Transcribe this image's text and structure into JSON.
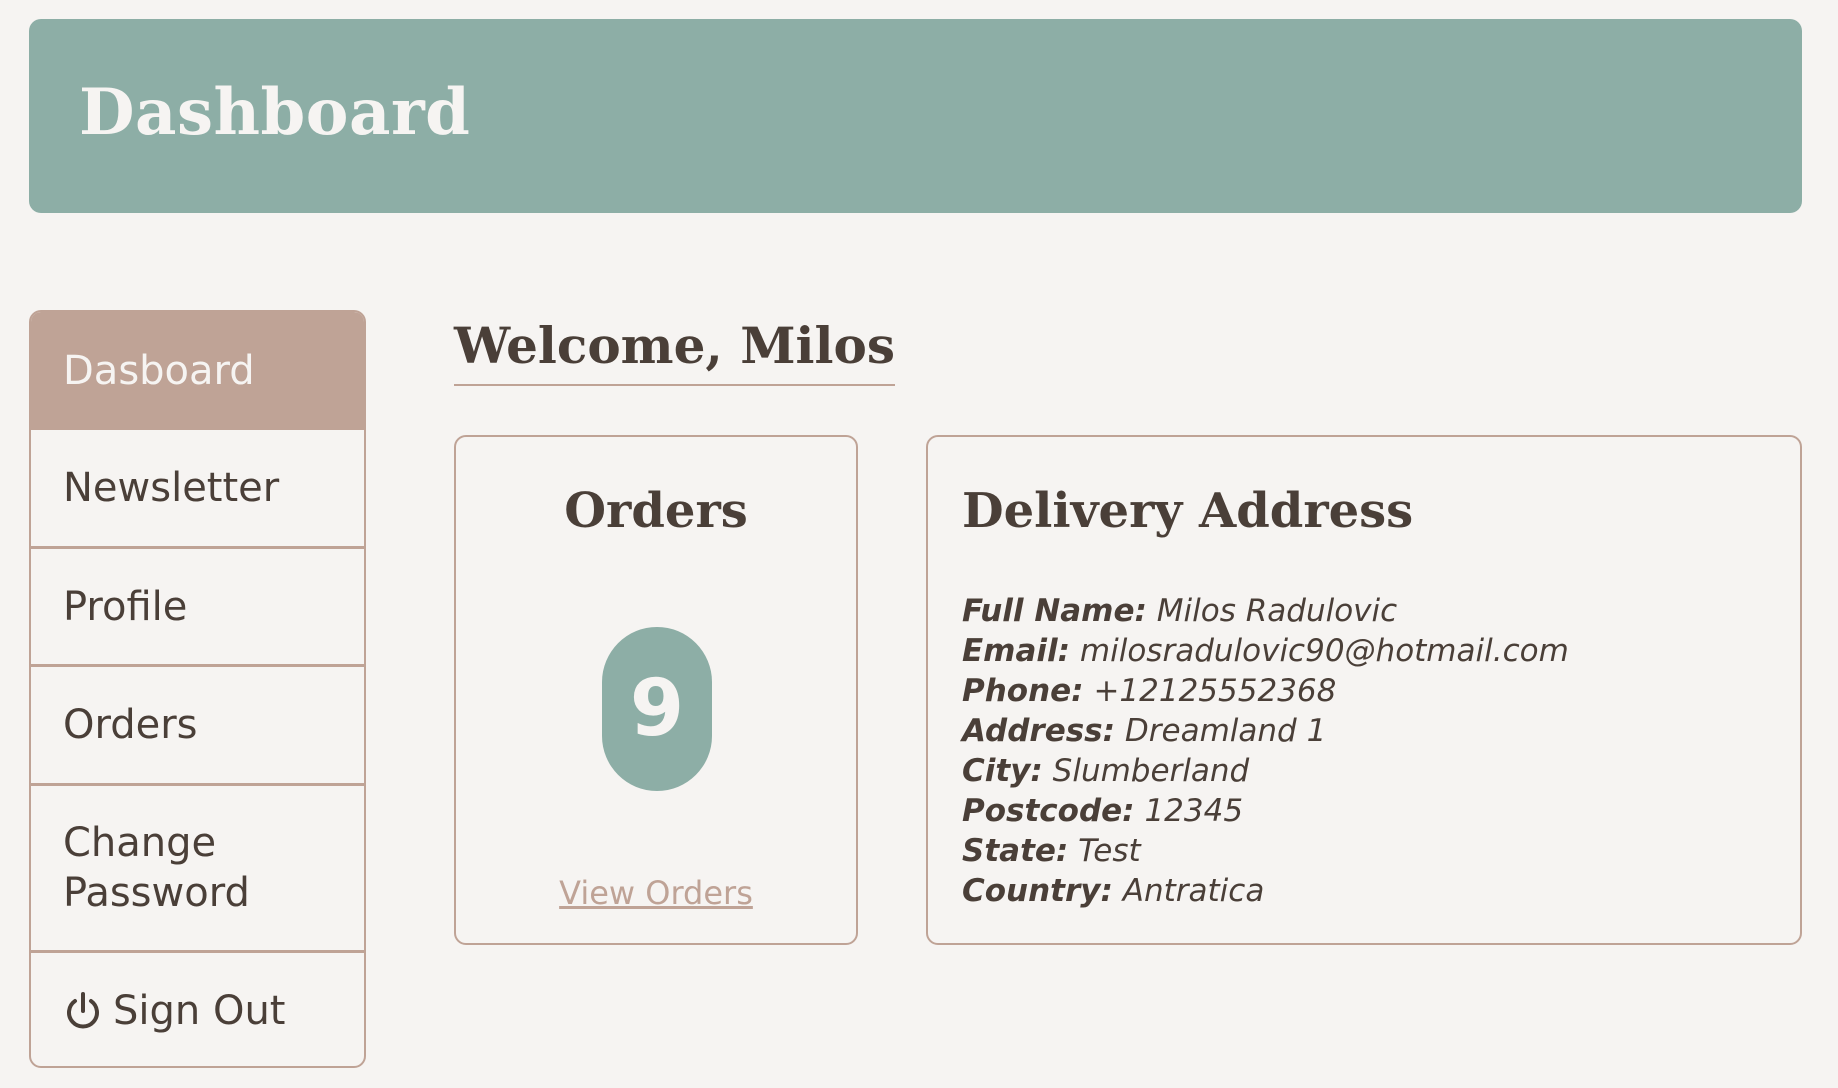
{
  "header": {
    "title": "Dashboard"
  },
  "sidebar": {
    "items": [
      {
        "label": "Dasboard",
        "active": true
      },
      {
        "label": "Newsletter"
      },
      {
        "label": "Profile"
      },
      {
        "label": "Orders"
      },
      {
        "label": "Change Password"
      },
      {
        "label": "Sign Out",
        "icon": "power-icon"
      }
    ]
  },
  "main": {
    "welcome": "Welcome, Milos",
    "orders_card": {
      "title": "Orders",
      "count": "9",
      "link": "View Orders"
    },
    "address_card": {
      "title": "Delivery Address",
      "fields": [
        {
          "label": "Full Name:",
          "value": "Milos Radulovic"
        },
        {
          "label": "Email:",
          "value": "milosradulovic90@hotmail.com"
        },
        {
          "label": "Phone:",
          "value": "+12125552368"
        },
        {
          "label": "Address:",
          "value": "Dreamland 1"
        },
        {
          "label": "City:",
          "value": "Slumberland"
        },
        {
          "label": "Postcode:",
          "value": "12345"
        },
        {
          "label": "State:",
          "value": "Test"
        },
        {
          "label": "Country:",
          "value": "Antratica"
        }
      ]
    }
  },
  "colors": {
    "background": "#f6f4f2",
    "accent_teal": "#8daea6",
    "accent_tan": "#bfa396",
    "text_dark": "#4a3f38"
  }
}
